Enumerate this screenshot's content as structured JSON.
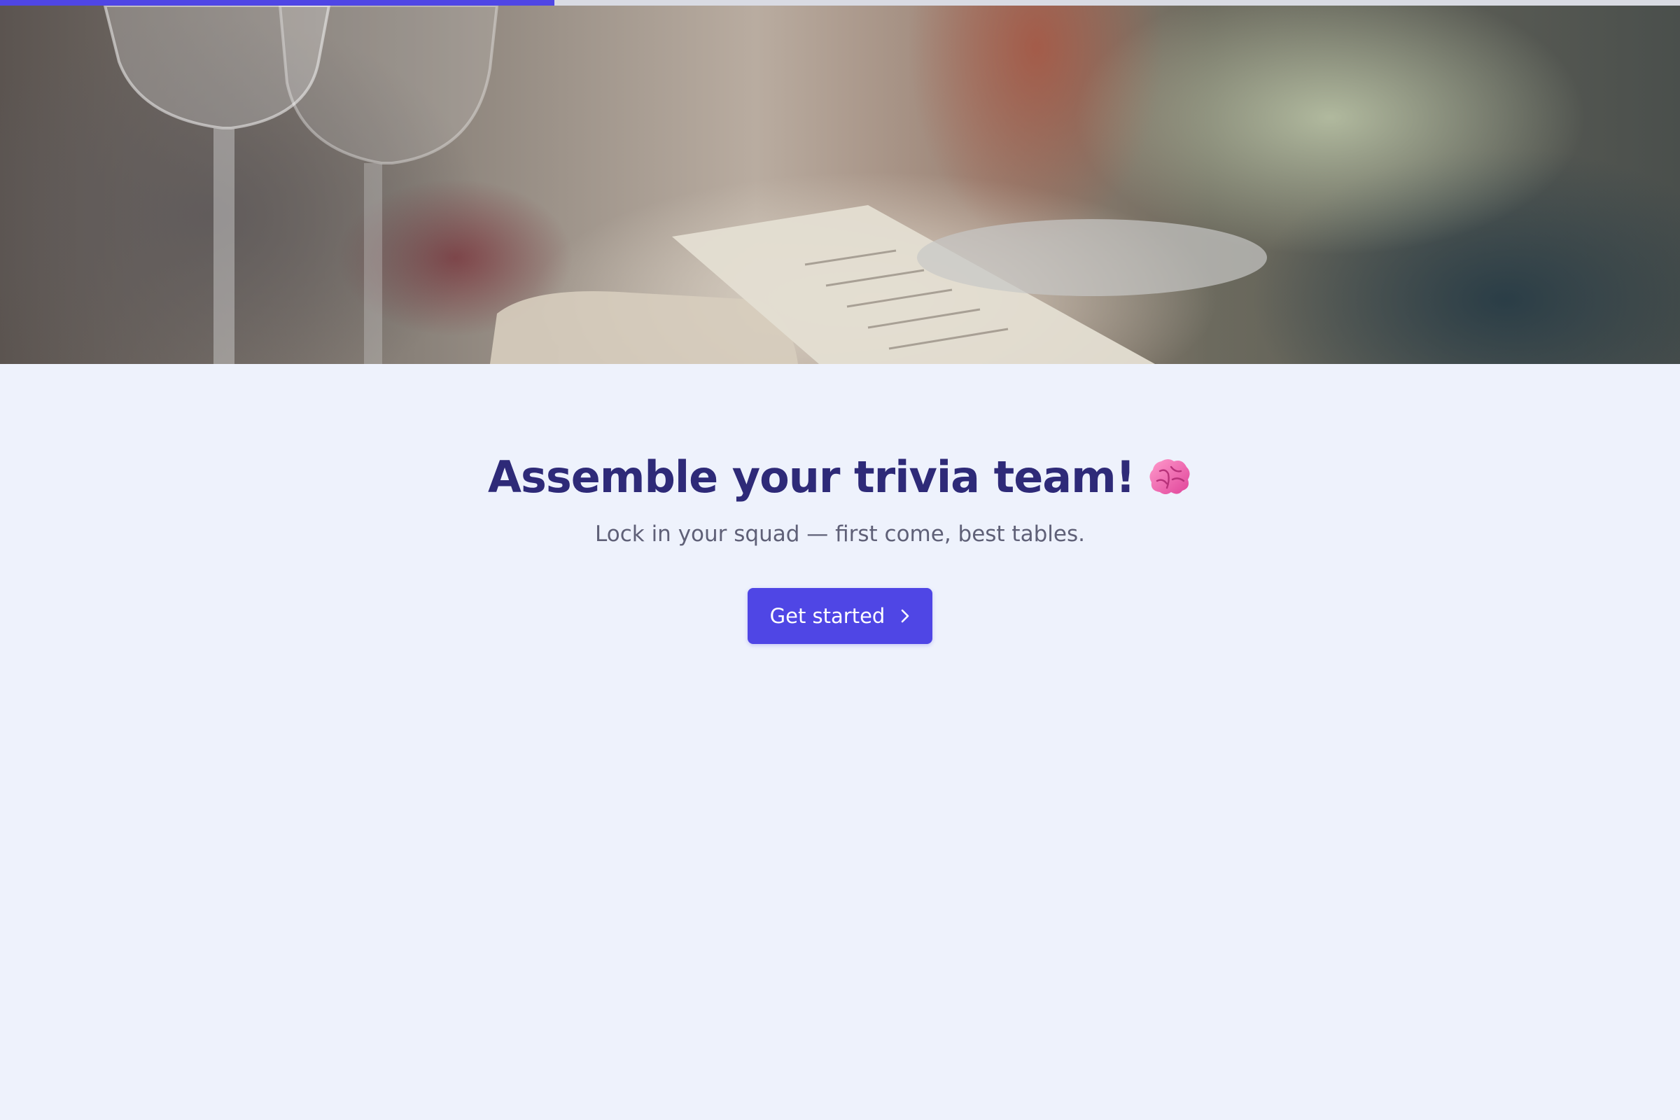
{
  "progress": {
    "fraction": 0.33,
    "fill_color": "#4f46e5",
    "track_color": "#d9dbe3"
  },
  "hero": {
    "image": "dinner-table-photo"
  },
  "main": {
    "headline": "Assemble your trivia team!",
    "headline_icon": "brain-icon",
    "subheadline": "Lock in your squad — first come, best tables.",
    "cta_label": "Get started",
    "cta_icon": "chevron-right-icon"
  },
  "colors": {
    "accent": "#4f46e5",
    "headline": "#2e2a78",
    "subtext": "#5f6077",
    "background": "#eef2fc"
  }
}
